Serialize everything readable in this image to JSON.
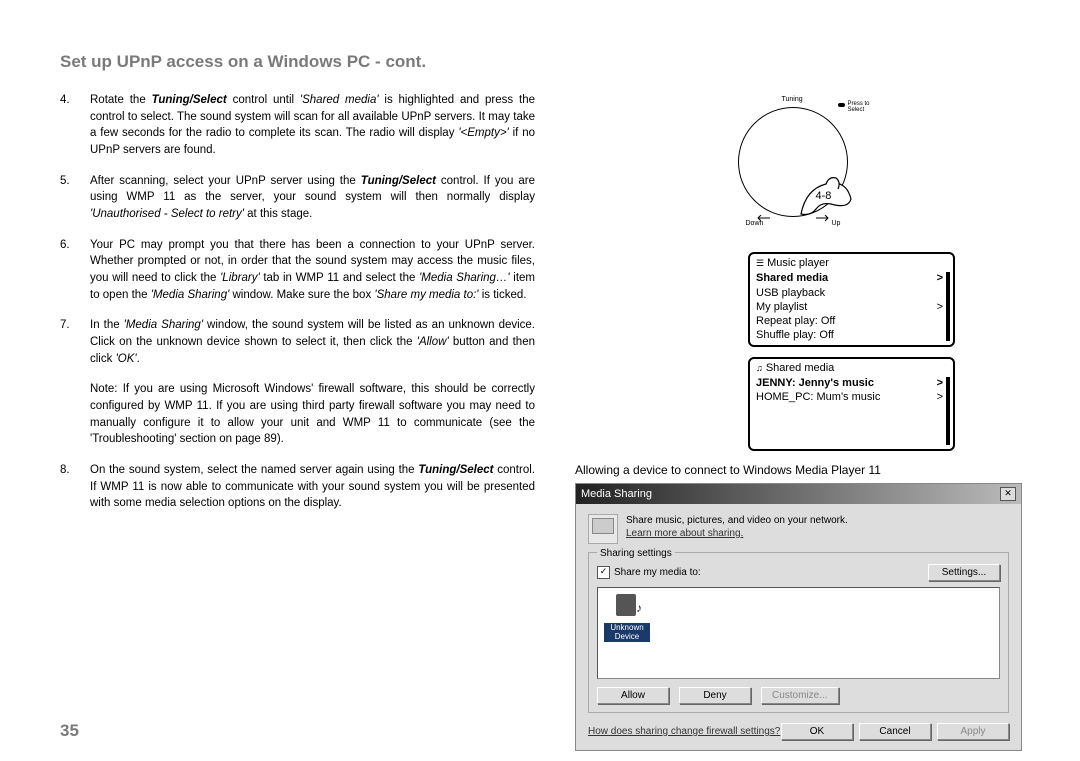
{
  "title": "Set up UPnP access on a Windows PC - cont.",
  "steps": [
    {
      "n": "4.",
      "html": "Rotate the <b><i>Tuning/Select</i></b> control until <i>'Shared media'</i> is highlighted and press the control to select. The sound system will scan for all available UPnP servers. It may take a few seconds for the radio to complete its scan. The radio will display <i>'&lt;Empty&gt;'</i> if no UPnP servers are found."
    },
    {
      "n": "5.",
      "html": "After scanning, select your UPnP server using the <b><i>Tuning/Select</i></b> control. If you are using WMP 11 as the server, your sound system will then normally display <i>'Unauthorised - Select to retry'</i> at this stage."
    },
    {
      "n": "6.",
      "html": "Your PC may prompt you that there has been a connection to your UPnP server. Whether prompted or not, in order that the sound system may access the music files, you will need to click the <i>'Library'</i> tab in WMP 11 and select the <i>'Media Sharing…'</i> item to open the <i>'Media Sharing'</i> window. Make sure the box <i>'Share my media to:'</i> is ticked."
    },
    {
      "n": "7.",
      "html": "In the <i>'Media Sharing'</i> window, the sound system will be listed as an unknown device. Click on the unknown device shown to select it, then click the <i>'Allow'</i> button and then click <i>'OK'</i>."
    }
  ],
  "note": "Note: If you are using Microsoft Windows' firewall software, this should be correctly configured by WMP 11. If you are using third party firewall software you may need to manually configure it to allow your unit and WMP 11 to communicate (see the 'Troubleshooting' section on page 89).",
  "step8": {
    "n": "8.",
    "html": "On the sound system, select the named server again using the <b><i>Tuning/Select</i></b> control. If WMP 11 is now able to communicate with your sound system you will be presented with some media selection options on the display."
  },
  "dial": {
    "tuning": "Tuning",
    "press": "Press to\nSelect",
    "down": "Down",
    "up": "Up",
    "range": "4-8"
  },
  "lcd1": {
    "header": "Music player",
    "items": [
      {
        "label": "Shared media",
        "chev": ">",
        "sel": true
      },
      {
        "label": "USB playback",
        "chev": ""
      },
      {
        "label": "My playlist",
        "chev": ">"
      },
      {
        "label": "Repeat play: Off",
        "chev": ""
      },
      {
        "label": "Shuffle play: Off",
        "chev": ""
      }
    ]
  },
  "lcd2": {
    "header": "Shared media",
    "items": [
      {
        "label": "JENNY: Jenny's music",
        "chev": ">",
        "sel": true
      },
      {
        "label": "HOME_PC: Mum's music",
        "chev": ">"
      }
    ]
  },
  "caption": "Allowing a device to connect to Windows Media Player 11",
  "win": {
    "title": "Media Sharing",
    "topline": "Share music, pictures, and video on your network.",
    "learn": "Learn more about sharing.",
    "legend": "Sharing settings",
    "share_label": "Share my media to:",
    "settings_btn": "Settings...",
    "device_label": "Unknown\nDevice",
    "allow": "Allow",
    "deny": "Deny",
    "customize": "Customize...",
    "firewall": "How does sharing change firewall settings?",
    "ok": "OK",
    "cancel": "Cancel",
    "apply": "Apply"
  },
  "pagenum": "35"
}
